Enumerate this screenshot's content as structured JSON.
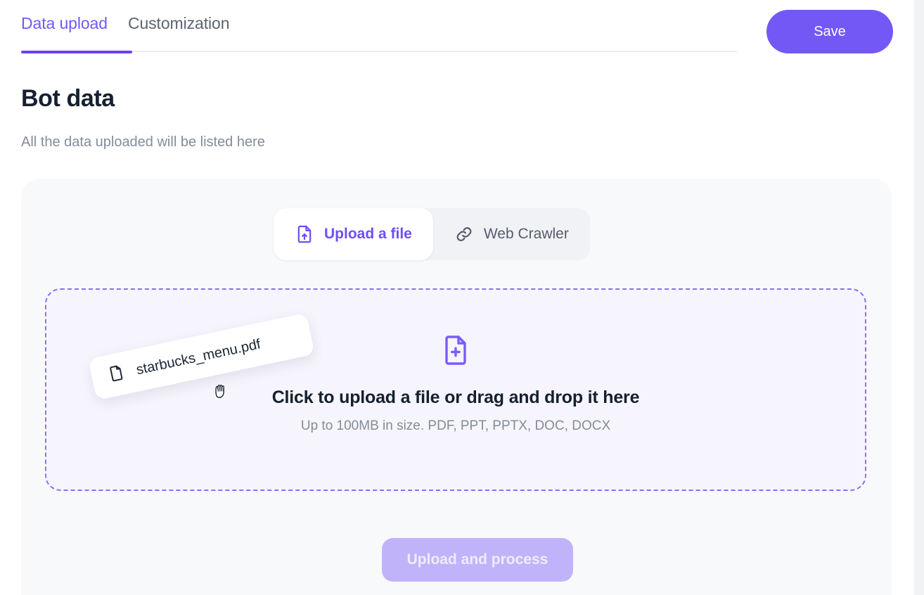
{
  "window": {
    "top_tabs": [
      {
        "label": "Data upload",
        "active": true
      },
      {
        "label": "Customization",
        "active": false
      }
    ],
    "save_label": "Save"
  },
  "header": {
    "title": "Bot data",
    "subtitle": "All the data uploaded will be listed here"
  },
  "source_tabs": [
    {
      "label": "Upload a file",
      "icon": "file-upload-icon",
      "active": true
    },
    {
      "label": "Web Crawler",
      "icon": "link-chain-icon",
      "active": false
    }
  ],
  "dropzone": {
    "icon": "file-plus-icon",
    "title": "Click to upload a file or drag and drop it here",
    "subtitle": "Up to 100MB in size. PDF, PPT, PPTX, DOC, DOCX"
  },
  "dragged_file": {
    "name": "starbucks_menu.pdf",
    "icon": "document-icon",
    "cursor": "grabbing-hand-cursor"
  },
  "actions": {
    "upload_label": "Upload and process"
  },
  "colors": {
    "accent": "#6c3ef4",
    "accent_soft": "#8b6ff7",
    "save_button": "#7458f6",
    "upload_button_disabled": "#c1b3fa",
    "card_bg": "#f8f9fb",
    "dropzone_bg": "#f6f5fe",
    "title": "#16202f",
    "muted_text": "#848b99"
  }
}
